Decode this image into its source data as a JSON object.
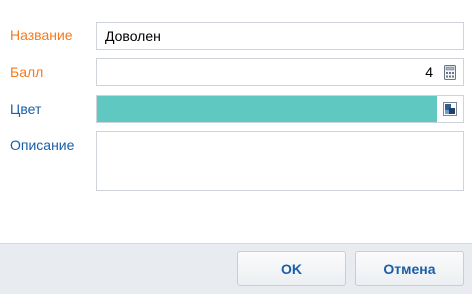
{
  "form": {
    "name": {
      "label": "Название",
      "value": "Доволен"
    },
    "score": {
      "label": "Балл",
      "value": "4",
      "icon": "calculator-icon"
    },
    "color": {
      "label": "Цвет",
      "value": "#5ec8c1",
      "icon": "color-picker-icon"
    },
    "description": {
      "label": "Описание",
      "value": ""
    }
  },
  "footer": {
    "ok_label": "OK",
    "cancel_label": "Отмена"
  },
  "colors": {
    "required_label": "#f57a1f",
    "label": "#1a5ea8",
    "accent": "#1a5ea8"
  }
}
